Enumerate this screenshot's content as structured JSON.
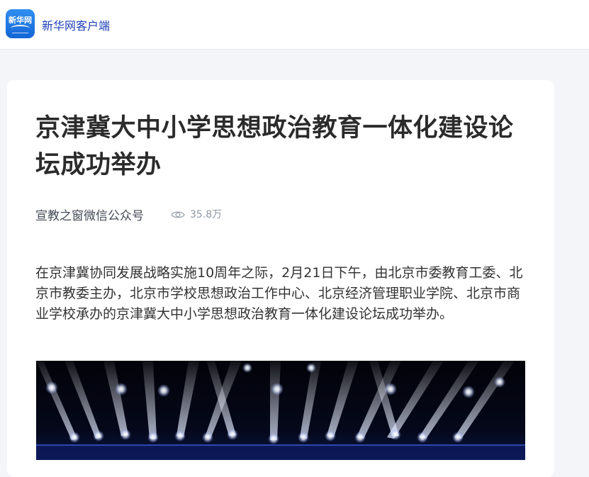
{
  "app": {
    "logo_text": "新华网",
    "name": "新华网客户端"
  },
  "article": {
    "title": "京津冀大中小学思想政治教育一体化建设论坛成功举办",
    "source": "宣教之窗微信公众号",
    "views": "35.8万",
    "paragraph": "在京津冀协同发展战略实施10周年之际，2月21日下午，由北京市委教育工委、北京市教委主办，北京市学校思想政治工作中心、北京经济管理职业学院、北京市商业学校承办的京津冀大中小学思想政治教育一体化建设论坛成功举办。",
    "image_icon": "stage-lights-photo"
  },
  "colors": {
    "accent": "#1d3fb8",
    "logo": "#1a73e8",
    "page_bg": "#f4f5f8"
  }
}
